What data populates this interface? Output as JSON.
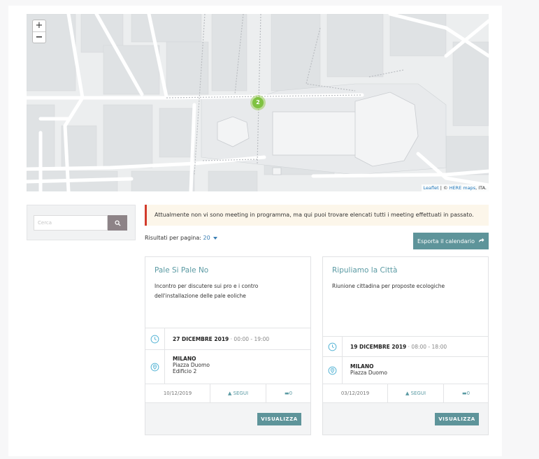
{
  "map": {
    "zoom_in": "+",
    "zoom_out": "−",
    "cluster_count": "2",
    "attribution_leaflet": "Leaflet",
    "attribution_sep": " | © ",
    "attribution_here": "HERE maps",
    "attribution_tail": ", ITA."
  },
  "search": {
    "placeholder": "Cerca"
  },
  "alert": {
    "message": "Attualmente non vi sono meeting in programma, ma qui puoi trovare elencati tutti i meeting effettuati in passato.",
    "accent_color": "#d23b2c"
  },
  "results": {
    "label": "Risultati per pagina:",
    "value": "20"
  },
  "export": {
    "label": "Esporta il calendario"
  },
  "cards": [
    {
      "title": "Pale Si Pale No",
      "description": "Incontro per discutere sui pro e i contro dell'installazione delle pale eoliche",
      "date": "27 DICEMBRE 2019",
      "time": " · 00:00 - 19:00",
      "city": "MILANO",
      "address1": "Piazza Duomo",
      "address2": "Edificio 2",
      "created": "10/12/2019",
      "follow": "SEGUI",
      "comments": "0",
      "view": "VISUALIZZA"
    },
    {
      "title": "Ripuliamo la Città",
      "description": "Riunione cittadina per proposte ecologiche",
      "date": "19 DICEMBRE 2019",
      "time": " · 08:00 - 18:00",
      "city": "MILANO",
      "address1": "Piazza Duomo",
      "address2": "",
      "created": "03/12/2019",
      "follow": "SEGUI",
      "comments": "0",
      "view": "VISUALIZZA"
    }
  ],
  "colors": {
    "accent": "#5e949a",
    "title": "#5a9aa3",
    "icon": "#5ab6d6",
    "alert_bg": "#fcf6ea"
  }
}
